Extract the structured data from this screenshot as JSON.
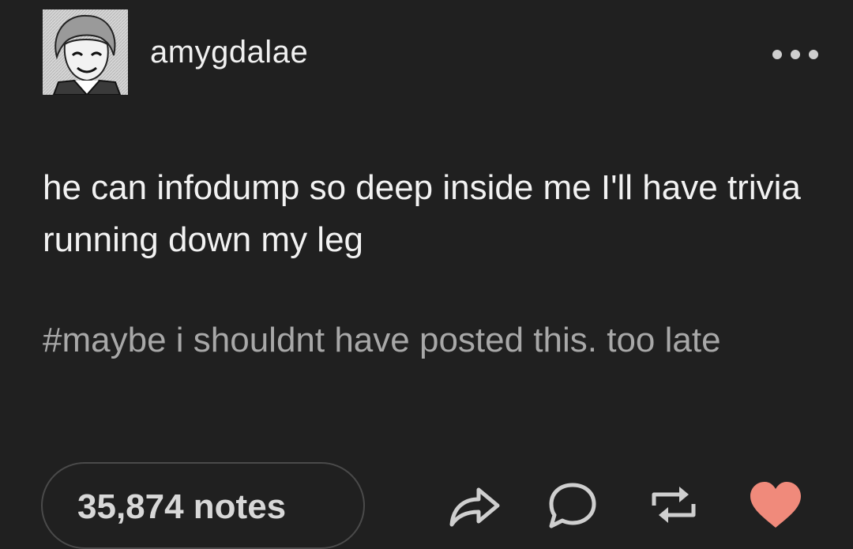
{
  "post": {
    "author": {
      "username": "amygdalae",
      "avatar_icon": "avatar-manga-portrait"
    },
    "body": "he can infodump so deep inside me I'll have trivia running down my leg",
    "tags": "#maybe i shouldnt have posted this. too late",
    "notes_label": "35,874 notes"
  },
  "actions": {
    "more_icon": "more-options-icon",
    "share_icon": "share-icon",
    "reply_icon": "reply-icon",
    "reblog_icon": "reblog-icon",
    "like_icon": "heart-icon",
    "like_color": "#f08a7b"
  },
  "colors": {
    "background": "#202020",
    "text": "#f2f2f2",
    "tags": "#a8a8a8"
  }
}
